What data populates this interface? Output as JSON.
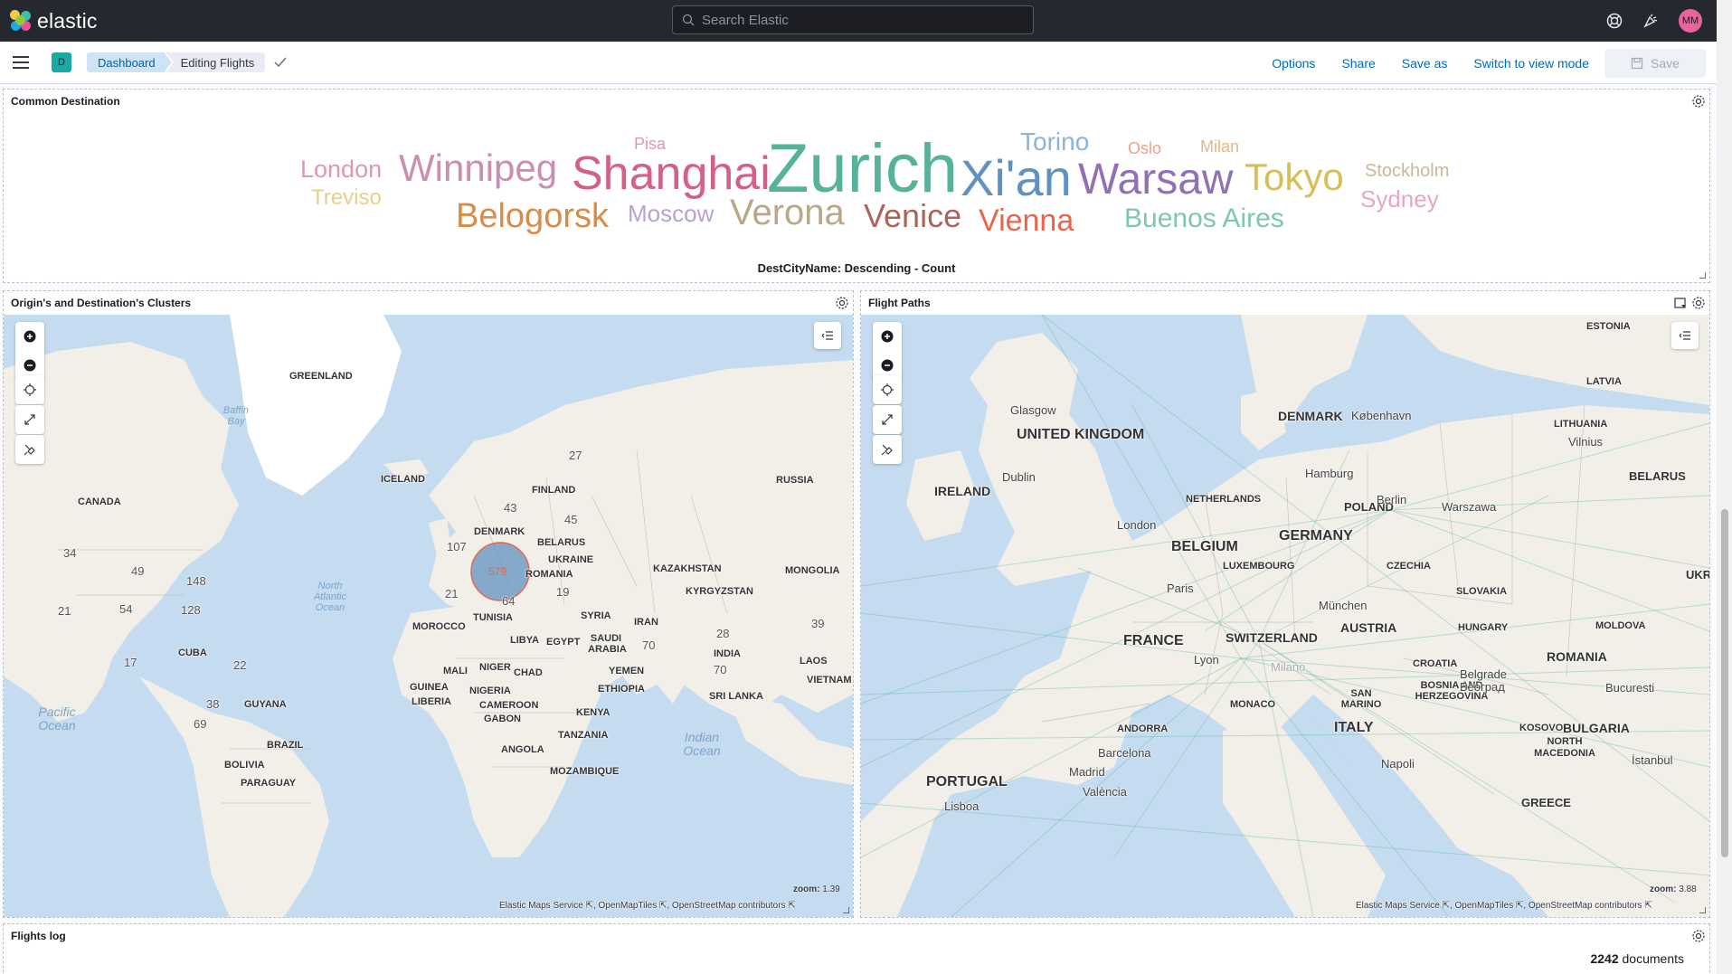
{
  "header": {
    "brand": "elastic",
    "search_placeholder": "Search Elastic",
    "avatar_initials": "MM",
    "icons": [
      "help-icon",
      "newsfeed-icon"
    ]
  },
  "subheader": {
    "space_initial": "D",
    "breadcrumbs": [
      "Dashboard",
      "Editing Flights"
    ],
    "actions": {
      "options": "Options",
      "share": "Share",
      "save_as": "Save as",
      "switch_mode": "Switch to view mode",
      "save": "Save"
    }
  },
  "colors": {
    "accent": "#006bb8",
    "header_bg": "#25282f",
    "space_badge": "#1ba9a5",
    "avatar": "#e7649d"
  },
  "panels": {
    "word_cloud": {
      "title": "Common Destination",
      "footer": "DestCityName: Descending - Count",
      "words": [
        {
          "text": "Zurich",
          "color": "#54b399"
        },
        {
          "text": "Xi'an",
          "color": "#6092c0"
        },
        {
          "text": "Shanghai",
          "color": "#d36086"
        },
        {
          "text": "Warsaw",
          "color": "#9170b8"
        },
        {
          "text": "Winnipeg",
          "color": "#ca8eae"
        },
        {
          "text": "Tokyo",
          "color": "#d6bf57"
        },
        {
          "text": "Verona",
          "color": "#b9a888"
        },
        {
          "text": "Belogorsk",
          "color": "#da8b45"
        },
        {
          "text": "Venice",
          "color": "#aa6556"
        },
        {
          "text": "Vienna",
          "color": "#e7664c"
        },
        {
          "text": "Buenos Aires",
          "color": "#7dc6b3"
        },
        {
          "text": "Moscow",
          "color": "#b8a2d4"
        },
        {
          "text": "London",
          "color": "#e196b2"
        },
        {
          "text": "Torino",
          "color": "#8bb4d9"
        },
        {
          "text": "Treviso",
          "color": "#e9cf87"
        },
        {
          "text": "Sydney",
          "color": "#e9a5c3"
        },
        {
          "text": "Stockholm",
          "color": "#c8b99a"
        },
        {
          "text": "Pisa",
          "color": "#e196b2"
        },
        {
          "text": "Oslo",
          "color": "#eea087"
        },
        {
          "text": "Milan",
          "color": "#e9b585"
        }
      ]
    },
    "clusters_map": {
      "title": "Origin's and Destination's Clusters",
      "zoom_label": "zoom:",
      "zoom_value": "1.39",
      "attribution": [
        "Elastic Maps Service",
        "OpenMapTiles",
        "OpenStreetMap contributors"
      ],
      "cluster_count": "579",
      "counts": [
        "27",
        "43",
        "45",
        "107",
        "148",
        "34",
        "49",
        "54",
        "128",
        "21",
        "21",
        "64",
        "19",
        "17",
        "22",
        "38",
        "69",
        "28",
        "39",
        "70",
        "70"
      ],
      "labels": [
        "GREENLAND",
        "ICELAND",
        "FINLAND",
        "RUSSIA",
        "DENMARK",
        "BELARUS",
        "UKRAINE",
        "ROMANIA",
        "KAZAKHSTAN",
        "MONGOLIA",
        "KYRGYZSTAN",
        "CANADA",
        "SYRIA",
        "IRAN",
        "MOROCCO",
        "TUNISIA",
        "LIBYA",
        "EGYPT",
        "SAUDI ARABIA",
        "INDIA",
        "LAOS",
        "VIETNAM",
        "SRI LANKA",
        "YEMEN",
        "MALI",
        "NIGER",
        "CHAD",
        "ETHIOPIA",
        "GUINEA",
        "LIBERIA",
        "NIGERIA",
        "CAMEROON",
        "GABON",
        "KENYA",
        "TANZANIA",
        "ANGOLA",
        "MOZAMBIQUE",
        "CUBA",
        "GUYANA",
        "BRAZIL",
        "BOLIVIA",
        "PARAGUAY"
      ],
      "oceans": [
        "Baffin Bay",
        "North Atlantic Ocean",
        "Pacific Ocean",
        "Indian Ocean"
      ]
    },
    "flight_paths": {
      "title": "Flight Paths",
      "zoom_label": "zoom:",
      "zoom_value": "3.88",
      "attribution": [
        "Elastic Maps Service",
        "OpenMapTiles",
        "OpenStreetMap contributors"
      ],
      "countries": [
        "ESTONIA",
        "LATVIA",
        "DENMARK",
        "LITHUANIA",
        "UNITED KINGDOM",
        "IRELAND",
        "BELARUS",
        "NETHERLANDS",
        "POLAND",
        "GERMANY",
        "BELGIUM",
        "LUXEMBOURG",
        "CZECHIA",
        "SLOVAKIA",
        "FRANCE",
        "SWITZERLAND",
        "AUSTRIA",
        "HUNGARY",
        "MOLDOVA",
        "ROMANIA",
        "CROATIA",
        "BOSNIA AND HERZEGOVINA",
        "SAN MARINO",
        "MONACO",
        "ANDORRA",
        "ITALY",
        "KOSOVO",
        "BULGARIA",
        "NORTH MACEDONIA",
        "PORTUGAL",
        "GREECE",
        "UKRA"
      ],
      "cities": [
        "Glasgow",
        "København",
        "Vilnius",
        "Dublin",
        "Hamburg",
        "Berlin",
        "Warszawa",
        "London",
        "Paris",
        "München",
        "Lyon",
        "Milano",
        "Belgrade",
        "Београд",
        "Bucuresti",
        "Barcelona",
        "Madrid",
        "València",
        "Napoli",
        "İstanbul",
        "Lisboa"
      ]
    },
    "flights_log": {
      "title": "Flights log",
      "doc_count": "2242",
      "doc_label": "documents"
    }
  }
}
